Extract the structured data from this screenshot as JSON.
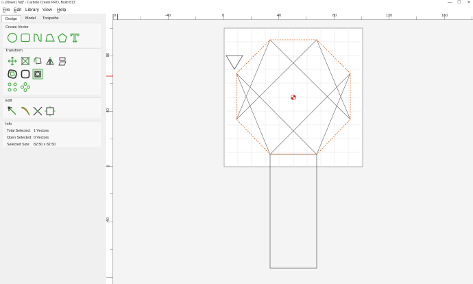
{
  "titlebar": {
    "title": "[Nowe1 fat]* - Carbide Create PRO, Build 813",
    "min": "—",
    "max": "☐",
    "close": "✕"
  },
  "menu": [
    {
      "first": "F",
      "rest": "ile"
    },
    {
      "first": "E",
      "rest": "dit"
    },
    {
      "first": "",
      "rest": "Library"
    },
    {
      "first": "",
      "rest": "View"
    },
    {
      "first": "H",
      "rest": "elp"
    }
  ],
  "tabs": [
    "Design",
    "Model",
    "Toolpaths"
  ],
  "active_tab": "Design",
  "sections": {
    "create_vector": "Create Vector",
    "transform": "Transform",
    "edit": "Edit",
    "info": "Info"
  },
  "tools": {
    "create_vector": [
      "circle-icon",
      "rectangle-icon",
      "curve-icon",
      "polyline-icon",
      "polygon-icon",
      "text-icon"
    ],
    "transform_row1": [
      "move-icon",
      "scale-icon",
      "rotate-icon",
      "mirror-icon",
      "shear-icon"
    ],
    "transform_row2": [
      "offset-icon",
      "fillet-icon",
      "boolean-icon"
    ],
    "transform_row3": [
      "align-icon",
      "array-icon"
    ],
    "edit": [
      "node-edit-icon",
      "trim-icon",
      "cut-icon",
      "bounding-box-icon"
    ]
  },
  "info": {
    "total_selected_label": "Total Selected:",
    "total_selected_value": "1 Vectors",
    "open_selected_label": "Open Selected:",
    "open_selected_value": "0 Vectors",
    "selected_size_label": "Selected Size:",
    "selected_size_value": "82.50 x 82.50"
  },
  "ruler_top_labels": [
    "0",
    "-40",
    "0",
    "40",
    "80",
    "120",
    "160"
  ],
  "ruler_left_labels": [
    "80",
    "40",
    "0",
    "-40"
  ],
  "colors": {
    "accent_green": "#3aa53a",
    "selection_orange": "#e06a20",
    "ruler_marker_red": "#e03030"
  }
}
